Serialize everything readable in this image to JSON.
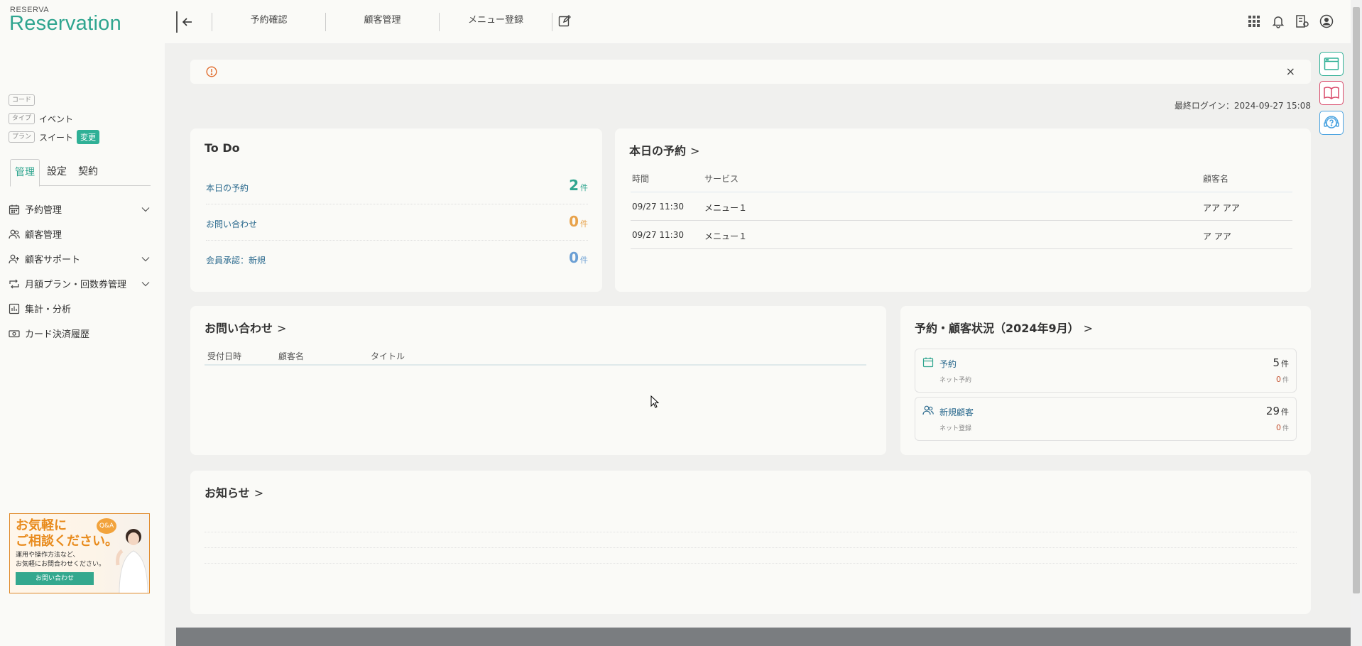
{
  "brand": {
    "small": "RESERVA",
    "big": "Reservation"
  },
  "meta": [
    {
      "tag": "コード",
      "value": ""
    },
    {
      "tag": "タイプ",
      "value": "イベント"
    },
    {
      "tag": "プラン",
      "value": "スイート",
      "button": "変更"
    }
  ],
  "side_tabs": [
    "管理",
    "設定",
    "契約"
  ],
  "side_tab_active": "管理",
  "menu": [
    {
      "label": "予約管理",
      "icon": "calendar-icon",
      "has_children": true
    },
    {
      "label": "顧客管理",
      "icon": "users-icon",
      "has_children": false
    },
    {
      "label": "顧客サポート",
      "icon": "user-plus-icon",
      "has_children": true
    },
    {
      "label": "月額プラン・回数券管理",
      "icon": "repeat-icon",
      "has_children": true
    },
    {
      "label": "集計・分析",
      "icon": "bar-chart-icon",
      "has_children": false
    },
    {
      "label": "カード決済履歴",
      "icon": "money-icon",
      "has_children": false
    }
  ],
  "banner": {
    "title_line1": "お気軽に",
    "title_line2": "ご相談ください。",
    "text_line1": "運用や操作方法など、",
    "text_line2": "お気軽にお問合わせください。",
    "button": "お問い合わせ",
    "badge": "Q&A"
  },
  "header": {
    "links": [
      "予約確認",
      "顧客管理",
      "メニュー登録"
    ],
    "icons": [
      "grid-icon",
      "bell-icon",
      "building-settings-icon",
      "account-icon"
    ]
  },
  "floating_buttons": [
    "browser-icon",
    "book-icon",
    "support-icon"
  ],
  "alert": {
    "close": "×"
  },
  "last_login": "最終ログイン：2024-09-27 15:08",
  "todo": {
    "title": "To Do",
    "items": [
      {
        "label": "本日の予約",
        "count": "2",
        "unit": "件",
        "color": "#2fa58f"
      },
      {
        "label": "お問い合わせ",
        "count": "0",
        "unit": "件",
        "color": "#e8a24a"
      },
      {
        "label": "会員承認：新規",
        "count": "0",
        "unit": "件",
        "color": "#6b9fd4"
      }
    ]
  },
  "today": {
    "title": "本日の予約",
    "columns": [
      "時間",
      "サービス",
      "顧客名"
    ],
    "rows": [
      [
        "09/27 11:30",
        "メニュー１",
        "アア アア"
      ],
      [
        "09/27 11:30",
        "メニュー１",
        "ア アア"
      ]
    ]
  },
  "inquiries": {
    "title": "お問い合わせ",
    "columns": [
      "受付日時",
      "顧客名",
      "タイトル"
    ]
  },
  "status": {
    "title": "予約・顧客状況（2024年9月）",
    "boxes": [
      {
        "name": "予約",
        "sub": "ネット予約",
        "value": "5",
        "unit": "件",
        "subvalue": "0",
        "subunit": "件",
        "icon": "calendar-icon"
      },
      {
        "name": "新規顧客",
        "sub": "ネット登録",
        "value": "29",
        "unit": "件",
        "subvalue": "0",
        "subunit": "件",
        "icon": "users-icon"
      }
    ]
  },
  "news": {
    "title": "お知らせ"
  },
  "colors": {
    "accent": "#2fa58f",
    "link": "#2b6a8e",
    "footer": "#7a7d80"
  }
}
